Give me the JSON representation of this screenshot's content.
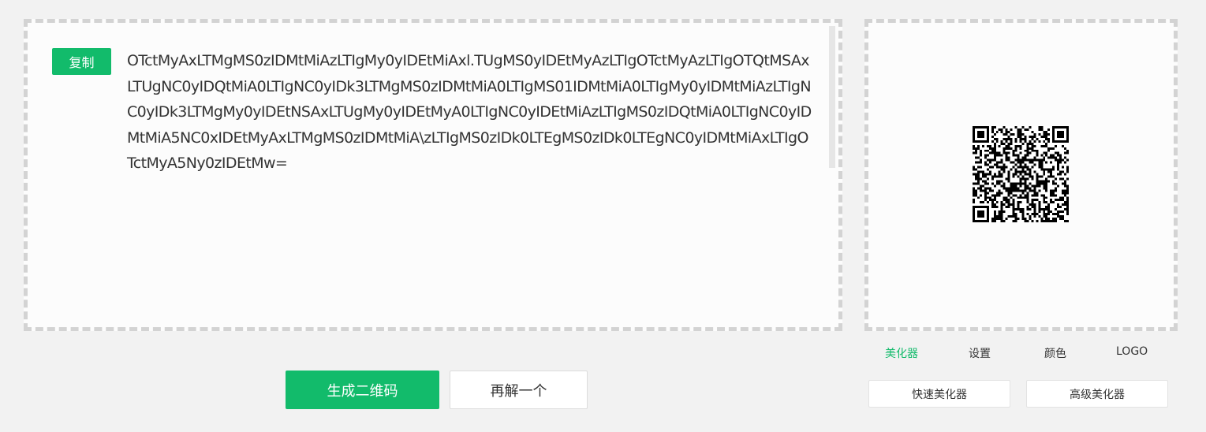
{
  "text_panel": {
    "copy_label": "复制",
    "decoded_text": "OTctMyAxLTMgMS0zIDMtMiAzLTIgMy0yIDEtMiAxl.TUgMS0yIDEtMyAzLTIgOTctMyAzLTIgOTQtMSAxLTUgNC0yIDQtMiA0LTIgNC0yIDk3LTMgMS0zIDMtMiA0LTIgMS01IDMtMiA0LTIgMy0yIDMtMiAzLTIgNC0yIDk3LTMgMy0yIDEtNSAxLTUgMy0yIDEtMyA0LTIgNC0yIDEtMiAzLTIgMS0zIDQtMiA0LTIgNC0yIDMtMiA5NC0xIDEtMyAxLTMgMS0zIDMtMiA\\zLTIgMS0zIDk0LTEgMS0zIDk0LTEgNC0yIDMtMiAxLTIgOTctMyA5Ny0zIDEtMw="
  },
  "qr_panel": {
    "tabs": [
      {
        "label": "美化器",
        "active": true
      },
      {
        "label": "设置",
        "active": false
      },
      {
        "label": "颜色",
        "active": false
      },
      {
        "label": "LOGO",
        "active": false
      }
    ],
    "quick_beautify_label": "快速美化器",
    "advanced_beautify_label": "高级美化器"
  },
  "actions": {
    "generate_label": "生成二维码",
    "decode_again_label": "再解一个"
  },
  "colors": {
    "accent": "#12bb6b",
    "background": "#f2f2f2"
  }
}
